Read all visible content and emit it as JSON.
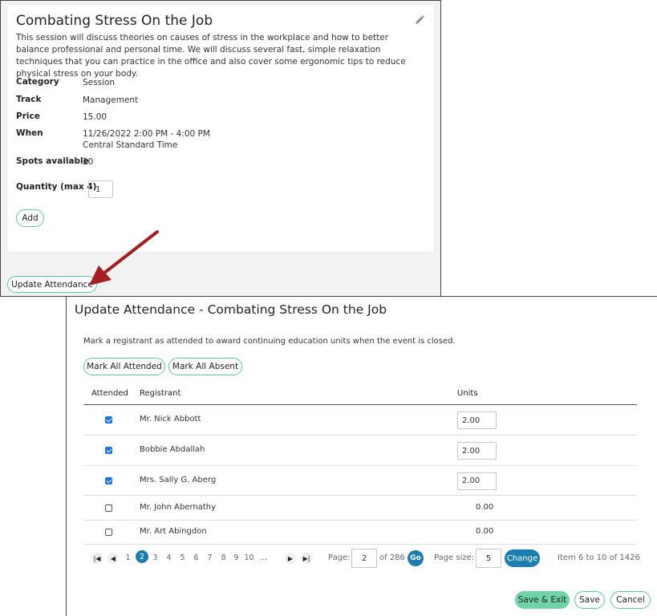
{
  "session": {
    "title": "Combating Stress On the Job",
    "description": "This session will discuss theories on causes of stress in the workplace and how to better balance professional and personal time. We will discuss several fast, simple relaxation techniques that you can practice in the office and also cover some ergonomic tips to reduce physical stress on your body.",
    "category_label": "Category",
    "category_value": "Session",
    "track_label": "Track",
    "track_value": "Management",
    "price_label": "Price",
    "price_value": "15.00",
    "when_label": "When",
    "when_value": "11/26/2022 2:00 PM - 4:00 PM",
    "when_timezone": "Central Standard Time",
    "spots_label": "Spots available",
    "spots_value": "20",
    "quantity_label": "Quantity (max 4)",
    "quantity_value": "1",
    "add_label": "Add",
    "edit_icon": "pencil-icon"
  },
  "update_attendance_label": "Update Attendance",
  "modal": {
    "title": "Update Attendance - Combating Stress On the Job",
    "intro": "Mark a registrant as attended to award continuing education units when the event is closed.",
    "mark_all_attended": "Mark All Attended",
    "mark_all_absent": "Mark All Absent",
    "columns": {
      "attended": "Attended",
      "registrant": "Registrant",
      "units": "Units"
    },
    "rows": [
      {
        "attended": true,
        "name": "Mr. Nick Abbott",
        "units": "2.00",
        "editable": true
      },
      {
        "attended": true,
        "name": "Bobbie Abdallah",
        "units": "2.00",
        "editable": true
      },
      {
        "attended": true,
        "name": "Mrs. Sally G. Aberg",
        "units": "2.00",
        "editable": true
      },
      {
        "attended": false,
        "name": "Mr. John Abernathy",
        "units": "0.00",
        "editable": false
      },
      {
        "attended": false,
        "name": "Mr. Art Abingdon",
        "units": "0.00",
        "editable": false
      }
    ],
    "pager": {
      "first": "◀",
      "prev": "◀",
      "next": "▶",
      "last": "▶",
      "pages": [
        "1",
        "2",
        "3",
        "4",
        "5",
        "6",
        "7",
        "8",
        "9",
        "10",
        "..."
      ],
      "current_page": "2",
      "page_label": "Page:",
      "page_value": "2",
      "of_label": "of 286",
      "go_label": "Go",
      "page_size_label": "Page size:",
      "page_size_value": "5",
      "change_label": "Change",
      "item_info": "Item 6 to 10 of 1426"
    },
    "save_exit": "Save & Exit",
    "save": "Save",
    "cancel": "Cancel"
  },
  "colors": {
    "accent": "#5bc8a6",
    "primary": "#1a7fb0",
    "arrow": "#a51e22",
    "checkbox": "#1a73e8"
  }
}
